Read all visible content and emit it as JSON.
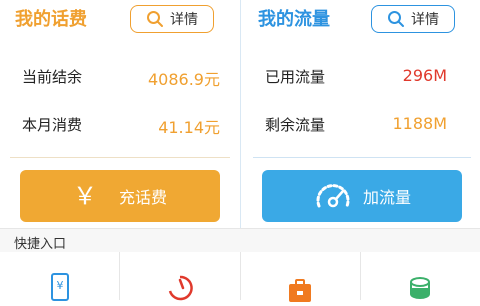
{
  "phone": {
    "title": "我的话费",
    "detail_label": "详情",
    "rows": [
      {
        "label": "当前结余",
        "value": "4086.9元"
      },
      {
        "label": "本月消费",
        "value": "41.14元"
      }
    ],
    "action": {
      "glyph": "￥",
      "label": "充话费"
    }
  },
  "data": {
    "title": "我的流量",
    "detail_label": "详情",
    "rows": [
      {
        "label": "已用流量",
        "value": "296M"
      },
      {
        "label": "剩余流量",
        "value": "1188M"
      }
    ],
    "action": {
      "label": "加流量"
    }
  },
  "quick": {
    "title": "快捷入口",
    "items": [
      {
        "icon": "bill-yen-icon"
      },
      {
        "icon": "timer-icon"
      },
      {
        "icon": "briefcase-icon"
      },
      {
        "icon": "coins-icon"
      }
    ]
  },
  "colors": {
    "orange": "#f0a030",
    "blue": "#2d93e0",
    "red": "#e0392c"
  }
}
